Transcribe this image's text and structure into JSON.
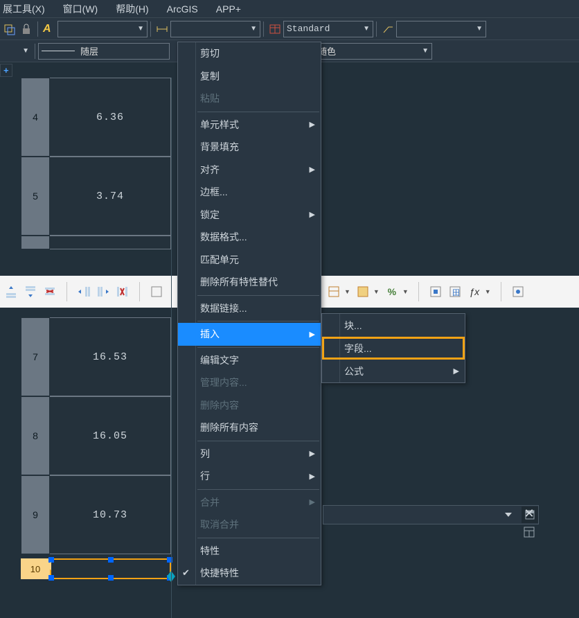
{
  "menubar": {
    "items": [
      {
        "label": "展工具(X)"
      },
      {
        "label": "窗口(W)"
      },
      {
        "label": "帮助(H)"
      },
      {
        "label": "ArcGIS"
      },
      {
        "label": "APP+"
      }
    ]
  },
  "toolbar1": {
    "textstyle_value": "",
    "dimstyle_value": "",
    "tablestyle_value": "Standard"
  },
  "toolbar2": {
    "line_label": "随层",
    "color_value": "随色"
  },
  "table_upper": [
    {
      "row": "4",
      "val": "6.36"
    },
    {
      "row": "5",
      "val": "3.74"
    }
  ],
  "table_lower": [
    {
      "row": "7",
      "val": "16.53"
    },
    {
      "row": "8",
      "val": "16.05"
    },
    {
      "row": "9",
      "val": "10.73"
    }
  ],
  "selected_row_number": "10",
  "context_menu": {
    "items": [
      {
        "label": "剪切"
      },
      {
        "label": "复制"
      },
      {
        "label": "粘贴",
        "disabled": true
      },
      {
        "sep": true
      },
      {
        "label": "单元样式",
        "submenu": true
      },
      {
        "label": "背景填充"
      },
      {
        "label": "对齐",
        "submenu": true
      },
      {
        "label": "边框..."
      },
      {
        "label": "锁定",
        "submenu": true
      },
      {
        "label": "数据格式..."
      },
      {
        "label": "匹配单元"
      },
      {
        "label": "删除所有特性替代"
      },
      {
        "sep": true
      },
      {
        "label": "数据链接..."
      },
      {
        "sep": true
      },
      {
        "label": "插入",
        "submenu": true,
        "highlight": true
      },
      {
        "sep": true
      },
      {
        "label": "编辑文字"
      },
      {
        "label": "管理内容...",
        "disabled": true
      },
      {
        "label": "删除内容",
        "disabled": true
      },
      {
        "label": "删除所有内容"
      },
      {
        "sep": true
      },
      {
        "label": "列",
        "submenu": true
      },
      {
        "label": "行",
        "submenu": true
      },
      {
        "sep": true
      },
      {
        "label": "合并",
        "disabled": true,
        "submenu": true
      },
      {
        "label": "取消合并",
        "disabled": true
      },
      {
        "sep": true
      },
      {
        "label": "特性"
      },
      {
        "label": "快捷特性",
        "checked": true
      }
    ]
  },
  "submenu": {
    "items": [
      {
        "label": "块..."
      },
      {
        "label": "字段...",
        "boxed": true
      },
      {
        "label": "公式",
        "submenu": true
      }
    ]
  },
  "whitebar": {
    "btn_fx": "ƒx"
  },
  "plus_tab": "+"
}
